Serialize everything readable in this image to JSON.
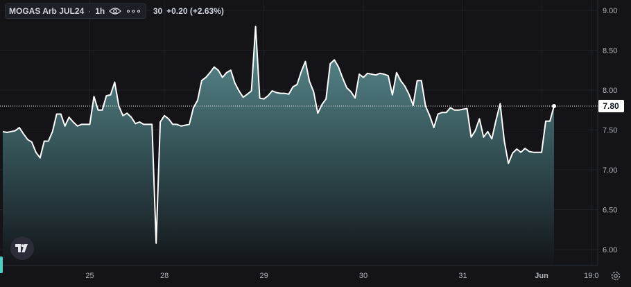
{
  "legend": {
    "title": "MOGAS Arb JUL24",
    "interval": "1h",
    "last_partial": "30",
    "change": "+0.20 (+2.63%)"
  },
  "price_label": "7.80",
  "colors": {
    "background": "#131318",
    "line": "#ffffff",
    "fill_top": "#5d8f93",
    "fill_bottom": "#131519",
    "grid": "#1f2128",
    "axis_text": "#b2b5be"
  },
  "icons": [
    "eye-icon",
    "more-icon",
    "tradingview-logo",
    "settings-icon"
  ],
  "chart_data": {
    "type": "area",
    "y_ticks": [
      "9.00",
      "8.50",
      "8.00",
      "7.50",
      "7.00",
      "6.50",
      "6.00"
    ],
    "ylim": [
      5.8,
      9.1
    ],
    "x_ticks": [
      {
        "label": "25",
        "i": 21
      },
      {
        "label": "28",
        "i": 39
      },
      {
        "label": "29",
        "i": 63
      },
      {
        "label": "30",
        "i": 87
      },
      {
        "label": "31",
        "i": 111
      },
      {
        "label": "Jun",
        "i": 130
      },
      {
        "label": "19:0",
        "i": 142
      }
    ],
    "grid": true,
    "last_value": 7.8,
    "values": [
      7.48,
      7.47,
      7.48,
      7.49,
      7.53,
      7.45,
      7.38,
      7.35,
      7.22,
      7.15,
      7.36,
      7.36,
      7.48,
      7.7,
      7.7,
      7.55,
      7.66,
      7.6,
      7.55,
      7.57,
      7.57,
      7.57,
      7.92,
      7.75,
      7.75,
      7.93,
      7.94,
      8.1,
      7.8,
      7.68,
      7.71,
      7.66,
      7.58,
      7.6,
      7.57,
      7.57,
      7.57,
      6.08,
      7.6,
      7.68,
      7.64,
      7.57,
      7.57,
      7.55,
      7.56,
      7.57,
      7.78,
      7.87,
      8.12,
      8.16,
      8.22,
      8.29,
      8.25,
      8.16,
      8.22,
      8.25,
      8.09,
      7.99,
      7.91,
      7.95,
      7.99,
      8.8,
      7.9,
      7.89,
      7.93,
      7.99,
      7.97,
      7.96,
      7.96,
      7.95,
      8.04,
      8.07,
      8.23,
      8.36,
      8.11,
      7.98,
      7.71,
      7.82,
      7.89,
      8.33,
      8.38,
      8.29,
      8.15,
      8.03,
      7.98,
      7.9,
      8.2,
      8.16,
      8.21,
      8.2,
      8.19,
      8.21,
      8.2,
      8.18,
      7.94,
      8.22,
      8.12,
      8.05,
      7.95,
      7.81,
      8.12,
      8.12,
      7.8,
      7.68,
      7.53,
      7.7,
      7.72,
      7.72,
      7.78,
      7.75,
      7.75,
      7.76,
      7.77,
      7.41,
      7.49,
      7.64,
      7.41,
      7.48,
      7.39,
      7.62,
      7.83,
      7.36,
      7.08,
      7.21,
      7.26,
      7.22,
      7.27,
      7.23,
      7.22,
      7.22,
      7.22,
      7.61,
      7.61,
      7.8
    ]
  }
}
